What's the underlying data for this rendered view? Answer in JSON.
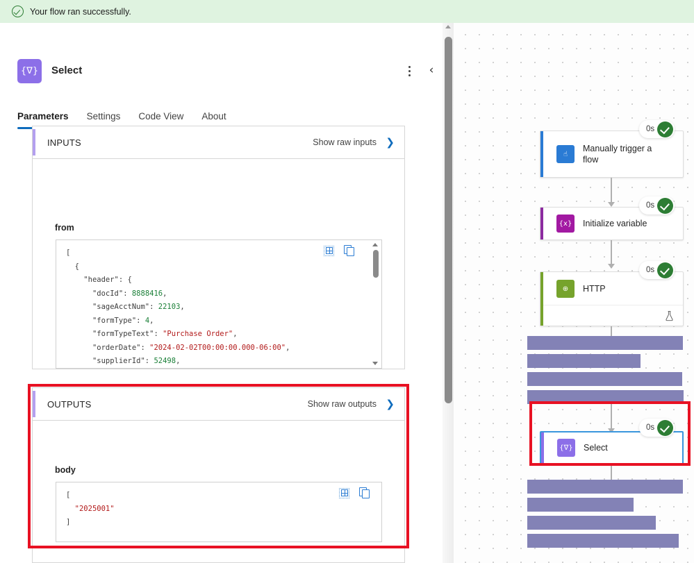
{
  "banner": {
    "icon": "check-circle-icon",
    "text": "Your flow ran successfully."
  },
  "detail_pane": {
    "node_icon_glyph": "{∇}",
    "title": "Select",
    "more_options_label": "⋮",
    "collapse_label": "‹",
    "tabs": [
      {
        "label": "Parameters",
        "active": true
      },
      {
        "label": "Settings",
        "active": false
      },
      {
        "label": "Code View",
        "active": false
      },
      {
        "label": "About",
        "active": false
      }
    ],
    "inputs_section": {
      "title": "INPUTS",
      "raw_link": "Show raw inputs",
      "chevron": "❯",
      "field_label": "from",
      "code_lines": [
        {
          "indent": 0,
          "parts": [
            {
              "t": "[",
              "c": "punct"
            }
          ]
        },
        {
          "indent": 1,
          "parts": [
            {
              "t": "{",
              "c": "punct"
            }
          ]
        },
        {
          "indent": 2,
          "parts": [
            {
              "t": "\"header\"",
              "c": "key"
            },
            {
              "t": ": {",
              "c": "punct"
            }
          ]
        },
        {
          "indent": 3,
          "parts": [
            {
              "t": "\"docId\"",
              "c": "key"
            },
            {
              "t": ": ",
              "c": "punct"
            },
            {
              "t": "8888416",
              "c": "num"
            },
            {
              "t": ",",
              "c": "punct"
            }
          ]
        },
        {
          "indent": 3,
          "parts": [
            {
              "t": "\"sageAcctNum\"",
              "c": "key"
            },
            {
              "t": ": ",
              "c": "punct"
            },
            {
              "t": "22103",
              "c": "num"
            },
            {
              "t": ",",
              "c": "punct"
            }
          ]
        },
        {
          "indent": 3,
          "parts": [
            {
              "t": "\"formType\"",
              "c": "key"
            },
            {
              "t": ": ",
              "c": "punct"
            },
            {
              "t": "4",
              "c": "num"
            },
            {
              "t": ",",
              "c": "punct"
            }
          ]
        },
        {
          "indent": 3,
          "parts": [
            {
              "t": "\"formTypeText\"",
              "c": "key"
            },
            {
              "t": ": ",
              "c": "punct"
            },
            {
              "t": "\"Purchase Order\"",
              "c": "str"
            },
            {
              "t": ",",
              "c": "punct"
            }
          ]
        },
        {
          "indent": 3,
          "parts": [
            {
              "t": "\"orderDate\"",
              "c": "key"
            },
            {
              "t": ": ",
              "c": "punct"
            },
            {
              "t": "\"2024-02-02T00:00:00.000-06:00\"",
              "c": "str"
            },
            {
              "t": ",",
              "c": "punct"
            }
          ]
        },
        {
          "indent": 3,
          "parts": [
            {
              "t": "\"supplierId\"",
              "c": "key"
            },
            {
              "t": ": ",
              "c": "punct"
            },
            {
              "t": "52498",
              "c": "num"
            },
            {
              "t": ",",
              "c": "punct"
            }
          ]
        }
      ],
      "tools": [
        "grid-view-icon",
        "copy-icon"
      ]
    },
    "outputs_section": {
      "title": "OUTPUTS",
      "raw_link": "Show raw outputs",
      "chevron": "❯",
      "field_label": "body",
      "code_lines": [
        {
          "indent": 0,
          "parts": [
            {
              "t": "[",
              "c": "punct"
            }
          ]
        },
        {
          "indent": 1,
          "parts": [
            {
              "t": "\"2025001\"",
              "c": "str"
            }
          ]
        },
        {
          "indent": 0,
          "parts": [
            {
              "t": "]",
              "c": "punct"
            }
          ]
        }
      ],
      "tools": [
        "grid-view-icon",
        "copy-icon"
      ]
    }
  },
  "flow_canvas": {
    "nodes": [
      {
        "id": "manually-trigger-a-flow",
        "label": "Manually trigger a flow",
        "icon_glyph": "☝",
        "icon_color": "#2a7bd4",
        "accent_color": "#2a7bd4",
        "duration": "0s",
        "status": "succeeded",
        "selected": false,
        "has_footer": false
      },
      {
        "id": "initialize-variable",
        "label": "Initialize variable",
        "icon_glyph": "{x}",
        "icon_color": "#a219a2",
        "accent_color": "#8c2ba0",
        "duration": "0s",
        "status": "succeeded",
        "selected": false,
        "has_footer": false
      },
      {
        "id": "http",
        "label": "HTTP",
        "icon_glyph": "⊕",
        "icon_color": "#76a32c",
        "accent_color": "#76a32c",
        "duration": "0s",
        "status": "succeeded",
        "selected": false,
        "has_footer": true,
        "footer_icon": "beaker-icon"
      },
      {
        "id": "select",
        "label": "Select",
        "icon_glyph": "{∇}",
        "icon_color": "#8c6fe8",
        "accent_color": "#8c6fe8",
        "duration": "0s",
        "status": "succeeded",
        "selected": true,
        "has_footer": false
      }
    ],
    "redacted_blocks": 8
  },
  "annotations": {
    "highlight_color": "#e81123",
    "boxes": [
      "outputs-section-highlight",
      "select-node-highlight"
    ]
  },
  "colors": {
    "banner_bg": "#dff3e0",
    "accent_blue": "#0f6cbd",
    "select_purple": "#8c6fe8",
    "success_green": "#2d7d34",
    "redact_purple": "#8382b6"
  }
}
